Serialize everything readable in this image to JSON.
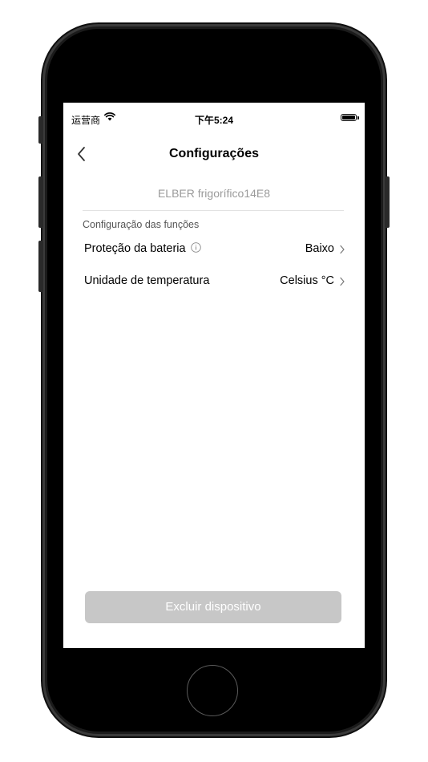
{
  "status_bar": {
    "carrier": "运营商",
    "time": "下午5:24",
    "battery_level": 1.0
  },
  "nav": {
    "title": "Configurações",
    "back_icon": "chevron-left-icon"
  },
  "device": {
    "name": "ELBER frigorífico14E8"
  },
  "settings": {
    "section_title": "Configuração das funções",
    "rows": [
      {
        "label": "Proteção da bateria",
        "value": "Baixo",
        "has_info_icon": true
      },
      {
        "label": "Unidade de temperatura",
        "value": "Celsius °C",
        "has_info_icon": false
      }
    ]
  },
  "actions": {
    "delete_label": "Excluir dispositivo",
    "delete_color": "#c7c7c7"
  }
}
